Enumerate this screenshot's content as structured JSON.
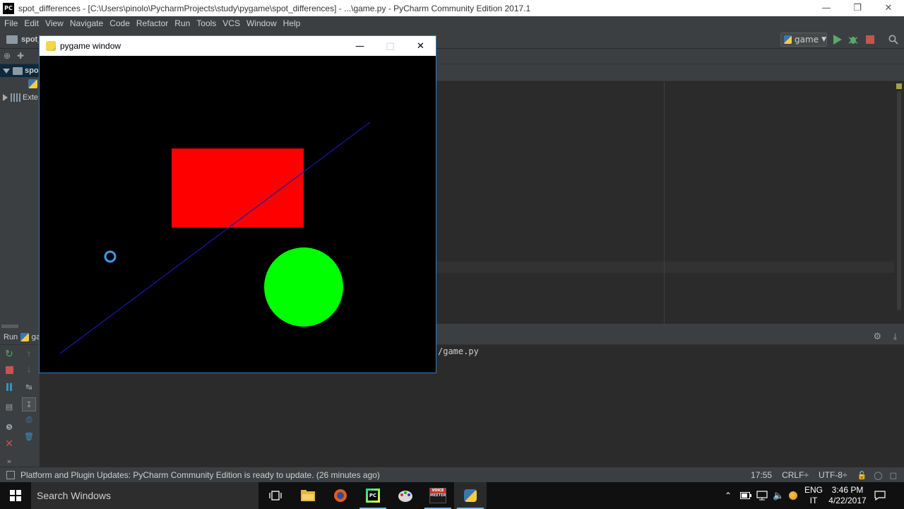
{
  "ide": {
    "window_title": "spot_differences - [C:\\Users\\pinolo\\PycharmProjects\\study\\pygame\\spot_differences] - ...\\game.py - PyCharm Community Edition 2017.1",
    "app_badge": "PC",
    "menu": [
      "File",
      "Edit",
      "View",
      "Navigate",
      "Code",
      "Refactor",
      "Run",
      "Tools",
      "VCS",
      "Window",
      "Help"
    ],
    "breadcrumb": "spot_d",
    "run_config": "game",
    "project_tree": [
      "spo",
      "Exte"
    ],
    "run_tab_label": "Run",
    "run_tab_name": "ga",
    "console_line": "/game.py",
    "accent": "#3c3f41"
  },
  "status": {
    "message": "Platform and Plugin Updates: PyCharm Community Edition is ready to update. (26 minutes ago)",
    "position": "17:55",
    "line_sep": "CRLF÷",
    "encoding": "UTF-8÷"
  },
  "pygame": {
    "title": "pygame window",
    "scene": {
      "rect_color": "#ff0000",
      "circle_color": "#00ff00",
      "line_color": "#1a1aa8",
      "ring_color": "#3d9be9"
    }
  },
  "taskbar": {
    "search_placeholder": "Search Windows",
    "lang_top": "ENG",
    "lang_bottom": "IT",
    "time": "3:46 PM",
    "date": "4/22/2017",
    "voicemeeter_top": "VOICE",
    "voicemeeter_bottom": "MEETER"
  }
}
